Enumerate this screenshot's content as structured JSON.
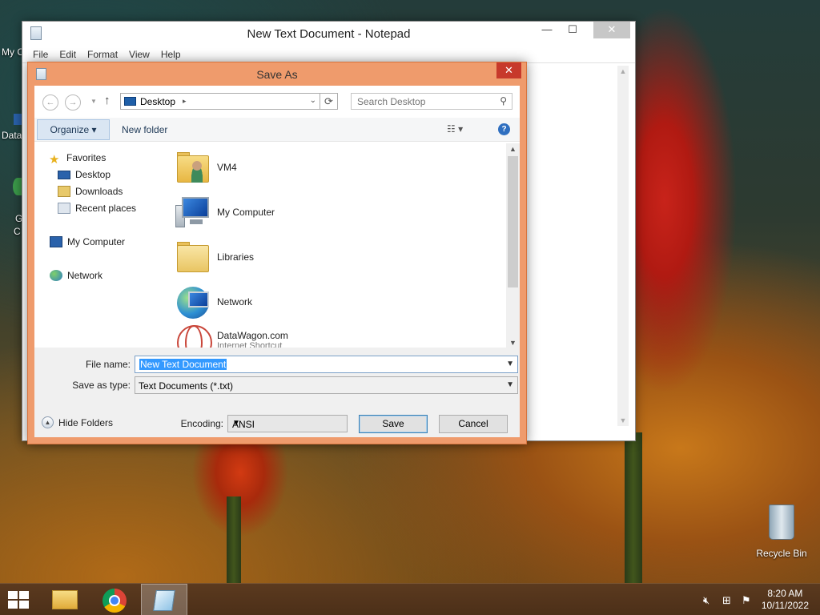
{
  "desktop": {
    "icons": [
      {
        "label": "My C"
      },
      {
        "label": "Data"
      },
      {
        "label": "G"
      },
      {
        "label": "C"
      },
      {
        "label": "Recycle Bin"
      }
    ]
  },
  "notepad": {
    "title": "New Text Document - Notepad",
    "menu": [
      "File",
      "Edit",
      "Format",
      "View",
      "Help"
    ],
    "controls": {
      "minimize": "—",
      "maximize": "☐",
      "close": "✕"
    }
  },
  "save_as": {
    "title": "Save As",
    "close": "✕",
    "nav": {
      "back": "←",
      "forward": "→",
      "up": "↑",
      "address": "Desktop",
      "address_sep": "▸",
      "refresh": "⟳",
      "search_placeholder": "Search Desktop"
    },
    "toolbar": {
      "organize": "Organize ▾",
      "new_folder": "New folder",
      "view": "☷ ▾",
      "help": "?"
    },
    "tree": {
      "favorites": "Favorites",
      "desktop": "Desktop",
      "downloads": "Downloads",
      "recent_places": "Recent places",
      "my_computer": "My Computer",
      "network": "Network"
    },
    "files": [
      {
        "name": "VM4",
        "sub": ""
      },
      {
        "name": "My Computer",
        "sub": ""
      },
      {
        "name": "Libraries",
        "sub": ""
      },
      {
        "name": "Network",
        "sub": ""
      },
      {
        "name": "DataWagon.com",
        "sub": "Internet Shortcut"
      }
    ],
    "file_name_label": "File name:",
    "file_name_value": "New Text Document",
    "save_type_label": "Save as type:",
    "save_type_value": "Text Documents (*.txt)",
    "hide_folders": "Hide Folders",
    "encoding_label": "Encoding:",
    "encoding_value": "ANSI",
    "save_button": "Save",
    "cancel_button": "Cancel"
  },
  "taskbar": {
    "time": "8:20 AM",
    "date": "10/11/2022"
  }
}
